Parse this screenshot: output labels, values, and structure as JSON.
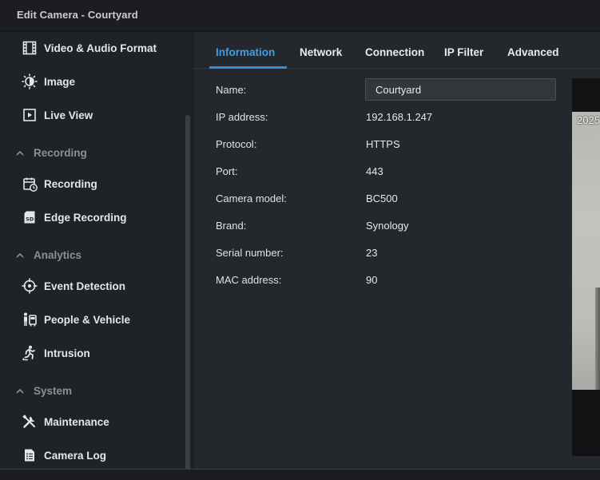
{
  "window": {
    "title": "Edit Camera - Courtyard"
  },
  "sidebar": {
    "items": [
      {
        "label": "Video & Audio Format",
        "icon": "film-icon"
      },
      {
        "label": "Image",
        "icon": "brightness-icon"
      },
      {
        "label": "Live View",
        "icon": "play-square-icon"
      }
    ],
    "sections": [
      {
        "label": "Recording",
        "items": [
          {
            "label": "Recording",
            "icon": "calendar-clock-icon"
          },
          {
            "label": "Edge Recording",
            "icon": "sd-card-icon"
          }
        ]
      },
      {
        "label": "Analytics",
        "items": [
          {
            "label": "Event Detection",
            "icon": "crosshair-icon"
          },
          {
            "label": "People & Vehicle",
            "icon": "person-vehicle-icon"
          },
          {
            "label": "Intrusion",
            "icon": "running-person-icon"
          }
        ]
      },
      {
        "label": "System",
        "items": [
          {
            "label": "Maintenance",
            "icon": "tools-icon"
          },
          {
            "label": "Camera Log",
            "icon": "document-list-icon"
          }
        ]
      }
    ]
  },
  "tabs": [
    "Information",
    "Network",
    "Connection",
    "IP Filter",
    "Advanced"
  ],
  "active_tab": "Information",
  "info": {
    "name_label": "Name:",
    "name_value": "Courtyard",
    "fields": [
      {
        "label": "IP address:",
        "value": "192.168.1.247"
      },
      {
        "label": "Protocol:",
        "value": "HTTPS"
      },
      {
        "label": "Port:",
        "value": "443"
      },
      {
        "label": "Camera model:",
        "value": "BC500"
      },
      {
        "label": "Brand:",
        "value": "Synology"
      },
      {
        "label": "Serial number:",
        "value": "23"
      },
      {
        "label": "MAC address:",
        "value": "90"
      }
    ]
  },
  "preview": {
    "timestamp": "2025"
  },
  "colors": {
    "accent": "#3aa0e8",
    "background": "#24272c",
    "sidebar": "#1f2226",
    "titlebar": "#1b1d21"
  }
}
